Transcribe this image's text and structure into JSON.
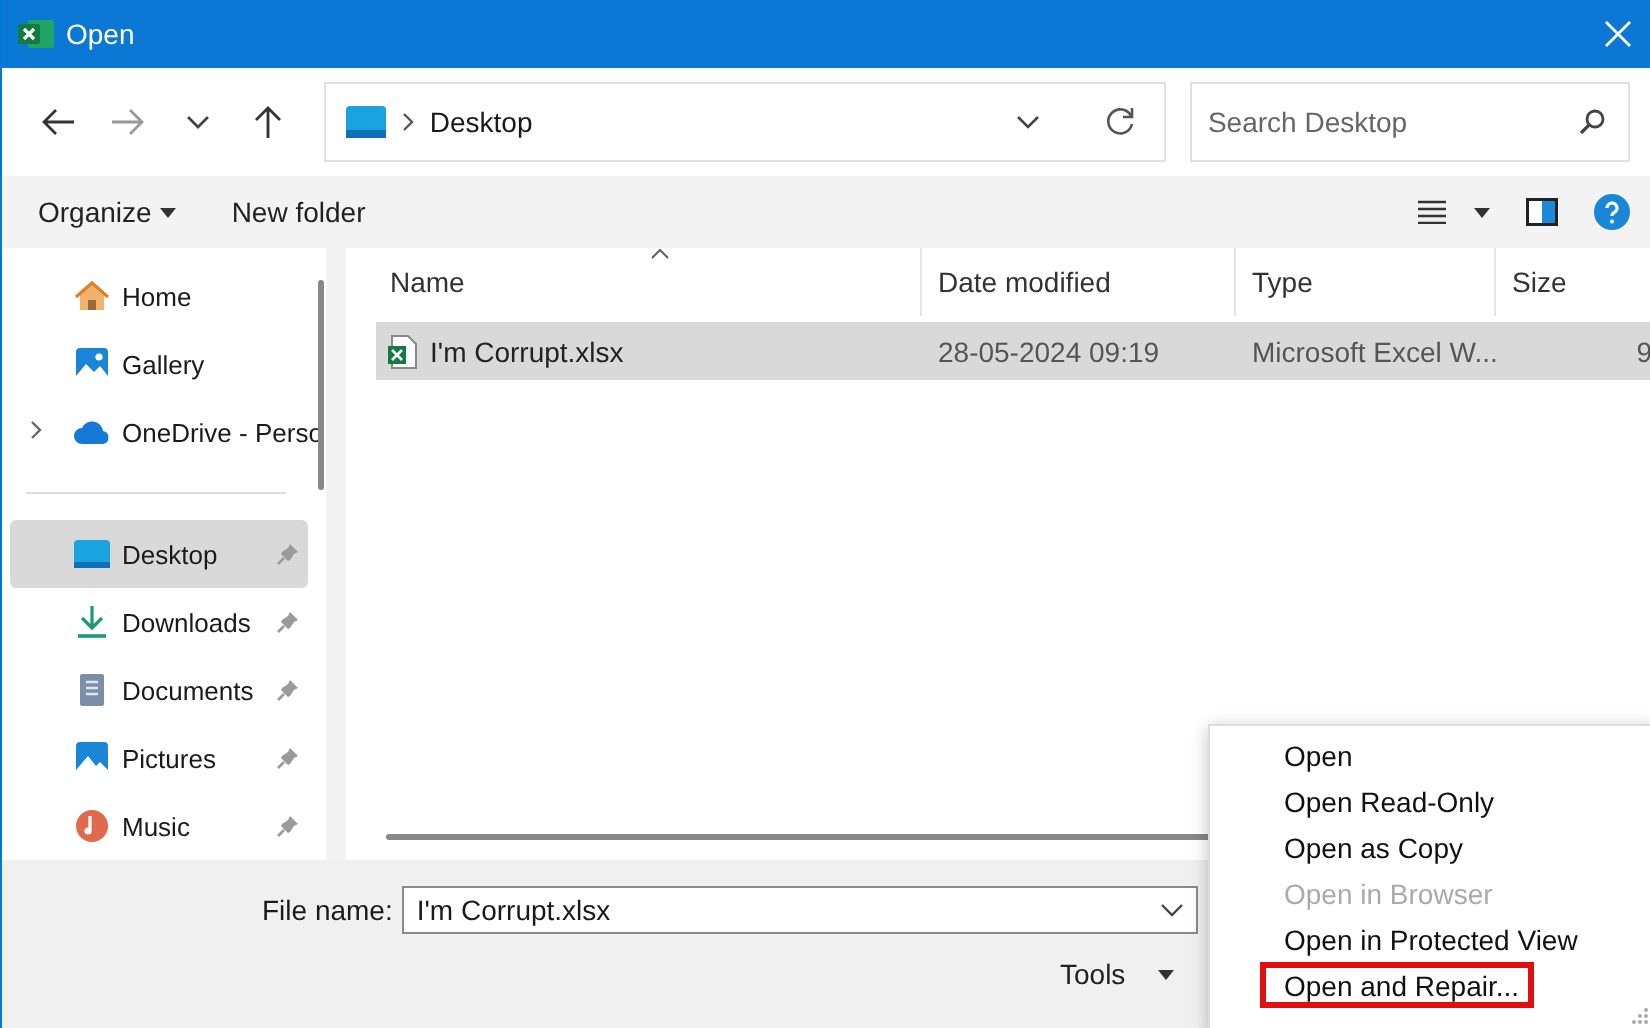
{
  "window": {
    "title": "Open"
  },
  "navigation": {
    "path": "Desktop",
    "search": {
      "placeholder": "Search Desktop"
    }
  },
  "toolbar": {
    "organize": "Organize",
    "new_folder": "New folder"
  },
  "sidebar": {
    "top_items": [
      {
        "label": "Home",
        "kind": "home",
        "selected": false,
        "pinned": false,
        "expandable": false
      },
      {
        "label": "Gallery",
        "kind": "gallery",
        "selected": false,
        "pinned": false,
        "expandable": false
      },
      {
        "label": "OneDrive - Perso",
        "kind": "cloud",
        "selected": false,
        "pinned": false,
        "expandable": true
      }
    ],
    "quick_access": [
      {
        "label": "Desktop",
        "kind": "desktop",
        "selected": true,
        "pinned": true,
        "expandable": false
      },
      {
        "label": "Downloads",
        "kind": "download",
        "selected": false,
        "pinned": true,
        "expandable": false
      },
      {
        "label": "Documents",
        "kind": "document",
        "selected": false,
        "pinned": true,
        "expandable": false
      },
      {
        "label": "Pictures",
        "kind": "pictures",
        "selected": false,
        "pinned": true,
        "expandable": false
      },
      {
        "label": "Music",
        "kind": "music",
        "selected": false,
        "pinned": true,
        "expandable": false
      }
    ]
  },
  "file_list": {
    "columns": [
      {
        "label": "Name",
        "sorted": true
      },
      {
        "label": "Date modified",
        "sorted": false
      },
      {
        "label": "Type",
        "sorted": false
      },
      {
        "label": "Size",
        "sorted": false
      }
    ],
    "rows": [
      {
        "name": "I'm Corrupt.xlsx",
        "date_modified": "28-05-2024 09:19",
        "type": "Microsoft Excel W...",
        "size": "9",
        "selected": true
      }
    ]
  },
  "file_name": {
    "label": "File name:",
    "value": "I'm Corrupt.xlsx"
  },
  "tools": {
    "label": "Tools"
  },
  "open_menu": {
    "items": [
      {
        "label": "Open",
        "disabled": false,
        "highlighted": false
      },
      {
        "label": "Open Read-Only",
        "disabled": false,
        "highlighted": false
      },
      {
        "label": "Open as Copy",
        "disabled": false,
        "highlighted": false
      },
      {
        "label": "Open in Browser",
        "disabled": true,
        "highlighted": false
      },
      {
        "label": "Open in Protected View",
        "disabled": false,
        "highlighted": false
      },
      {
        "label": "Open and Repair...",
        "disabled": false,
        "highlighted": true
      }
    ]
  }
}
